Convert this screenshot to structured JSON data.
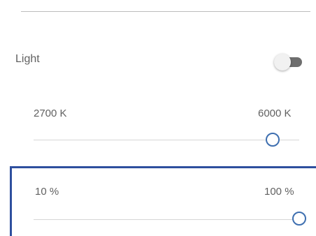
{
  "light": {
    "label": "Light",
    "toggle_on": false
  },
  "color_temperature": {
    "min_label": "2700 K",
    "max_label": "6000 K",
    "value_fraction": 0.9
  },
  "brightness": {
    "min_label": "10 %",
    "max_label": "100 %",
    "value_fraction": 1.0
  },
  "colors": {
    "accent": "#3e6fb0",
    "focus_outline": "#2e4f9e"
  }
}
